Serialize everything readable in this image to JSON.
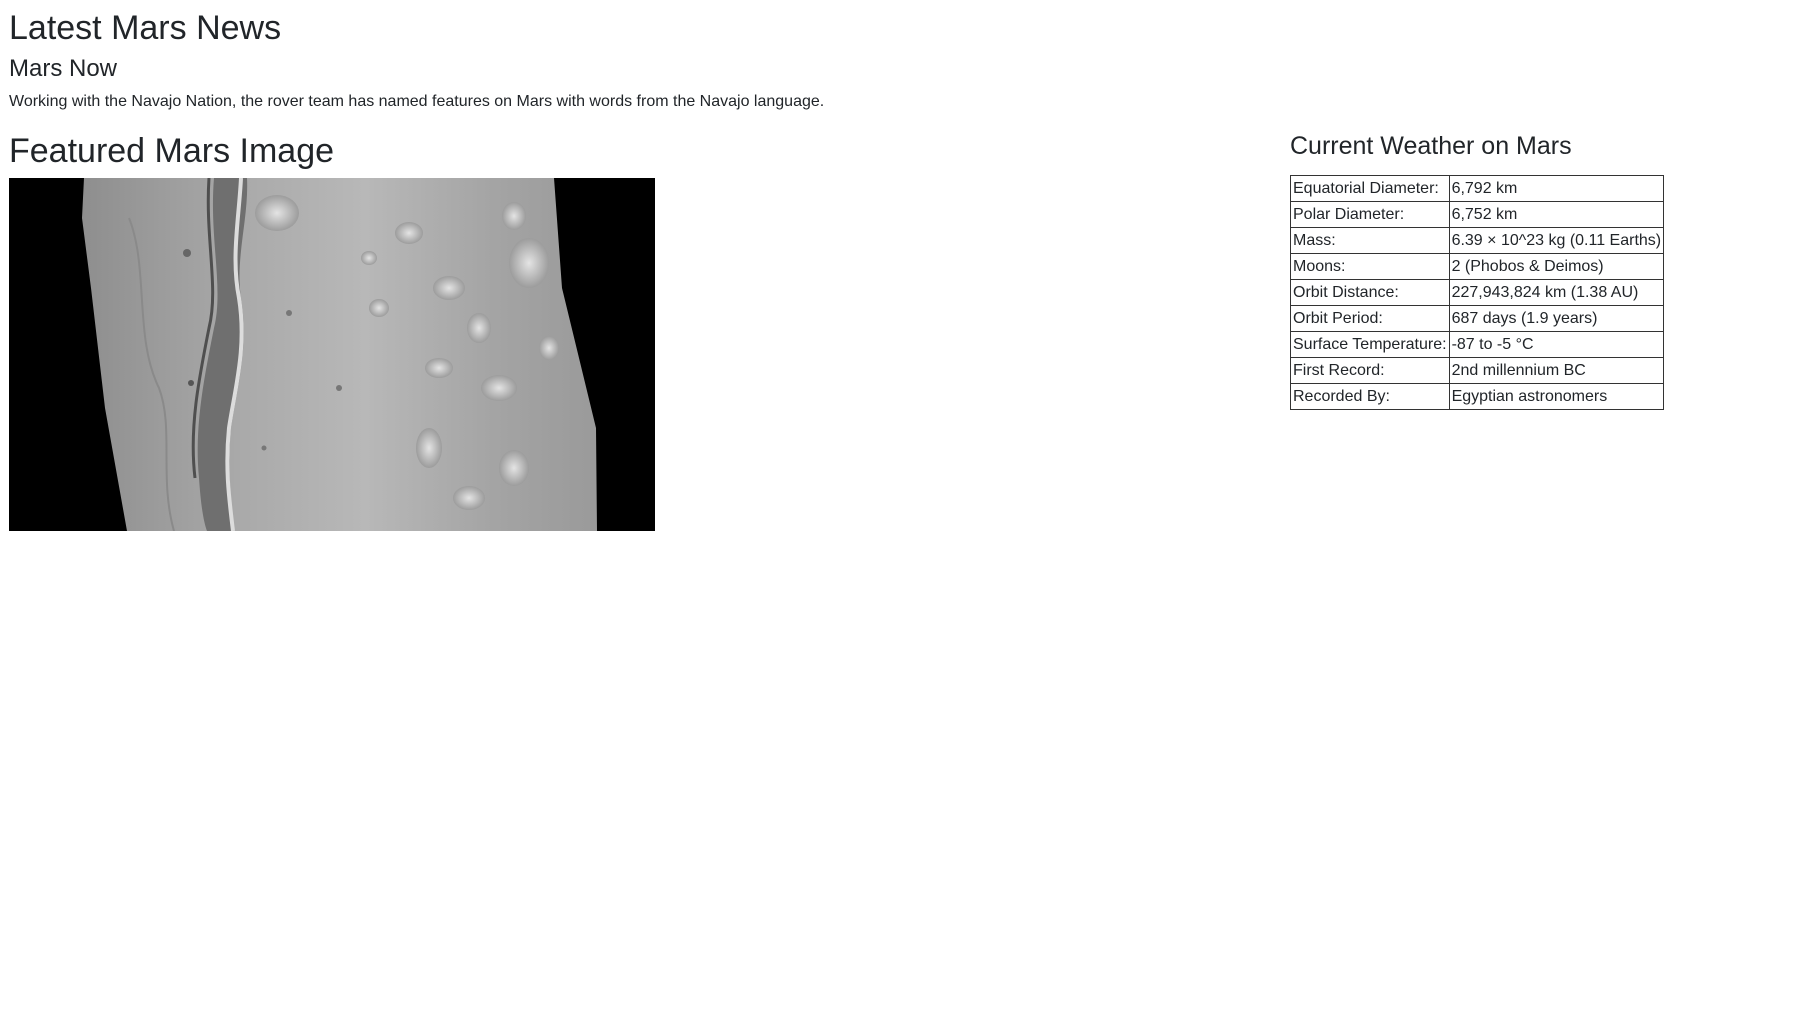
{
  "news": {
    "section_title": "Latest Mars News",
    "headline": "Mars Now",
    "teaser": "Working with the Navajo Nation, the rover team has named features on Mars with words from the Navajo language."
  },
  "featured_image": {
    "section_title": "Featured Mars Image"
  },
  "weather": {
    "section_title": "Current Weather on Mars",
    "facts": [
      {
        "label": "Equatorial Diameter:",
        "value": "6,792 km"
      },
      {
        "label": "Polar Diameter:",
        "value": "6,752 km"
      },
      {
        "label": "Mass:",
        "value": "6.39 × 10^23 kg (0.11 Earths)"
      },
      {
        "label": "Moons:",
        "value": "2 (Phobos & Deimos)"
      },
      {
        "label": "Orbit Distance:",
        "value": "227,943,824 km (1.38 AU)"
      },
      {
        "label": "Orbit Period:",
        "value": "687 days (1.9 years)"
      },
      {
        "label": "Surface Temperature:",
        "value": "-87 to -5 °C"
      },
      {
        "label": "First Record:",
        "value": "2nd millennium BC"
      },
      {
        "label": "Recorded By:",
        "value": "Egyptian astronomers"
      }
    ]
  }
}
